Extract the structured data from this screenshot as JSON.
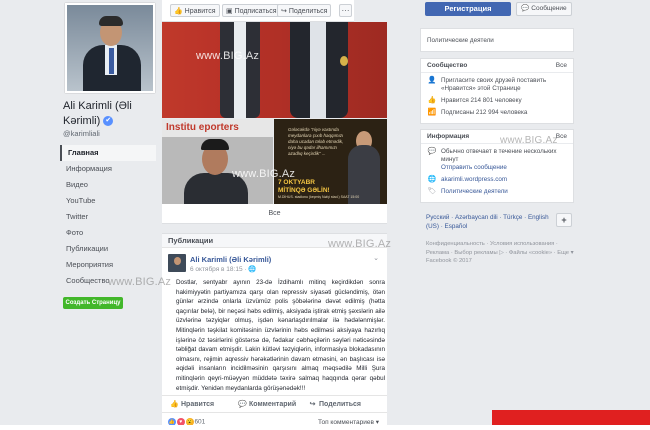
{
  "profile": {
    "name": "Ali Karimli (Əli Kərimli)",
    "verified_glyph": "✔",
    "username": "@karimliali"
  },
  "nav": {
    "items": [
      "Главная",
      "Информация",
      "Видео",
      "YouTube",
      "Twitter",
      "Фото",
      "Публикации",
      "Мероприятия",
      "Сообщество"
    ],
    "create_page": "Создать Страницу"
  },
  "topbar": {
    "like": "Нравится",
    "follow": "Подписаться",
    "share": "Поделиться",
    "more": "···"
  },
  "photos": {
    "left_banner": "Institu     eporters",
    "right_quote": "Gələcəkdə \"niyə vaxtında meydanlara çıxıb haqqımızı daha ucadan tələb etmədik, niyə bu qədər ilhamımızı azadlıq keçirdik\" ...",
    "rally_line1": "7 OKTYABR",
    "rally_line2": "MİTİNQƏ GƏLİN!",
    "rally_small": "M.DİHUS. stadionu (keçmiş Nəfçi stad.) SAAT 15:00",
    "see_all": "Все"
  },
  "watermarks": {
    "top": "www.BIG.Az",
    "mid": "www.BIG.Az",
    "left": "www.BIG.Az",
    "right_top": "www.BIG.Az"
  },
  "post": {
    "section_title": "Публикации",
    "author": "Ali Karimli (Əli Kərimli)",
    "date": "6 октября в 18:15 · ",
    "chevron": "⌄",
    "text": "Dostlar, sentyabr ayının 23-də İzdihamlı mitinq keçirdikdən sonra hakimiyyətin partiyamıza qarşı olan repressiv siyasəti gücləndimiş, ötən günlər ərzində onlarla üzvümüz polis şöbələrinə dəvət edilmiş (hətta qaçırılar belə), bir neçəsi həbs edilmiş, aksiyada iştirak etmiş şəxslərin ailə üzvlərinə təzyiqlər olmuş, işdən kənarlaşdırılmalar ilə hədələnmişlər. Mitinqlərin təşkilat komitəsinin üzvlərinin həbs edilməsi aksiyaya hazırlıq işlərinə öz təsirlərini göstərsə də, fədakar cəbhəçilərin səyləri nəticəsində təbliğat davam etmişdir. Lakin kütləvi təzyiqlərin, informasiya blokadasının olmasını, rejimin aqressiv hərəkətlərinin davam etməsini, ən başlıcası isə əqidəli insanların incidilməsinin qarşısını almaq məqsədilə Milli Şura mitinqlərin qeyri-müəyyən müddətə təxirə salmaq haqqında qərar qəbul etmişdir. Yenidən meydanlarda görüşənədək!!!",
    "actions": {
      "like": "Нравится",
      "comment": "Комментарий",
      "share": "Поделиться"
    },
    "reaction_count": "601",
    "sort": "Топ комментариев ▾"
  },
  "header_right": {
    "register": "Регистрация",
    "message": "Сообщение"
  },
  "category": {
    "label": "Политические деятели"
  },
  "community": {
    "title": "Сообщество",
    "see_all": "Все",
    "invite": "Пригласите своих друзей поставить «Нравится» этой Странице",
    "likes": "Нравится 214 801 человеку",
    "followers": "Подписаны 212 994 человека"
  },
  "info": {
    "title": "Информация",
    "see_all": "Все",
    "response": "Обычно отвечает в течение нескольких минут",
    "send_message": "Отправить сообщение",
    "website": "akarimli.wordpress.com",
    "category": "Политические деятели"
  },
  "languages": {
    "text": "Русский · Azərbaycan dili · Türkçe · English (US) · Español",
    "plus": "+"
  },
  "footer": {
    "text": "Конфиденциальность · Условия использования · Реклама · Выбор рекламы ▷ · Файлы «cookie» · Еще ▾",
    "copyright": "Facebook © 2017"
  },
  "colors": {
    "brand_blue": "#4267b2",
    "link_blue": "#385898",
    "create_green": "#42b72a"
  }
}
